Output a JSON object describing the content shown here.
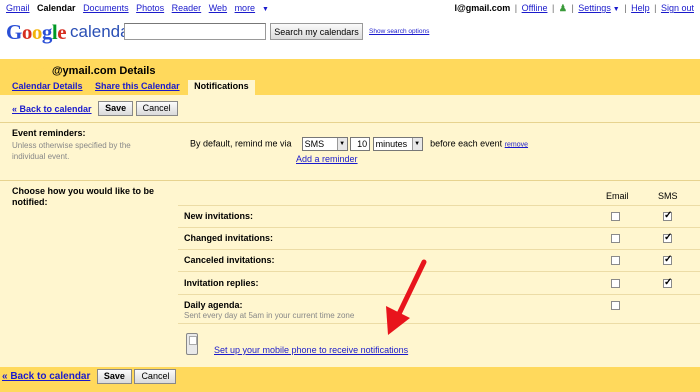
{
  "topnav": {
    "links": [
      "Gmail",
      "Calendar",
      "Documents",
      "Photos",
      "Reader",
      "Web",
      "more"
    ],
    "account": "l@gmail.com",
    "offline": "Offline",
    "settings": "Settings",
    "help": "Help",
    "signout": "Sign out"
  },
  "logo": {
    "google": "Google",
    "product": "calendar"
  },
  "search": {
    "value": "",
    "button": "Search my calendars",
    "options": "Show search options"
  },
  "page": {
    "title": "@ymail.com Details",
    "tabs": [
      "Calendar Details",
      "Share this Calendar",
      "Notifications"
    ],
    "back": "« Back to calendar",
    "save": "Save",
    "cancel": "Cancel"
  },
  "reminders": {
    "label": "Event reminders:",
    "help": "Unless otherwise specified by the individual event.",
    "prefix": "By default, remind me via",
    "method": "SMS",
    "amount": "10",
    "unit": "minutes",
    "suffix": "before each event",
    "remove": "remove",
    "add": "Add a reminder"
  },
  "notifications": {
    "label": "Choose how you would like to be notified:",
    "col_email": "Email",
    "col_sms": "SMS",
    "rows": [
      {
        "label": "New invitations:",
        "email": false,
        "sms": true
      },
      {
        "label": "Changed invitations:",
        "email": false,
        "sms": true
      },
      {
        "label": "Canceled invitations:",
        "email": false,
        "sms": true
      },
      {
        "label": "Invitation replies:",
        "email": false,
        "sms": true
      },
      {
        "label": "Daily agenda:",
        "email": false,
        "sms": null
      }
    ],
    "daily_sub": "Sent every day at 5am in your current time zone",
    "mobile_link": "Set up your mobile phone to receive notifications"
  },
  "colors": {
    "header_yellow": "#ffd95c",
    "content_yellow": "#fff6cf",
    "link_blue": "#1a1acc",
    "arrow_red": "#e8141c"
  },
  "icons": {
    "phone": "mobile-phone-icon",
    "arrow": "red-arrow-annotation"
  }
}
